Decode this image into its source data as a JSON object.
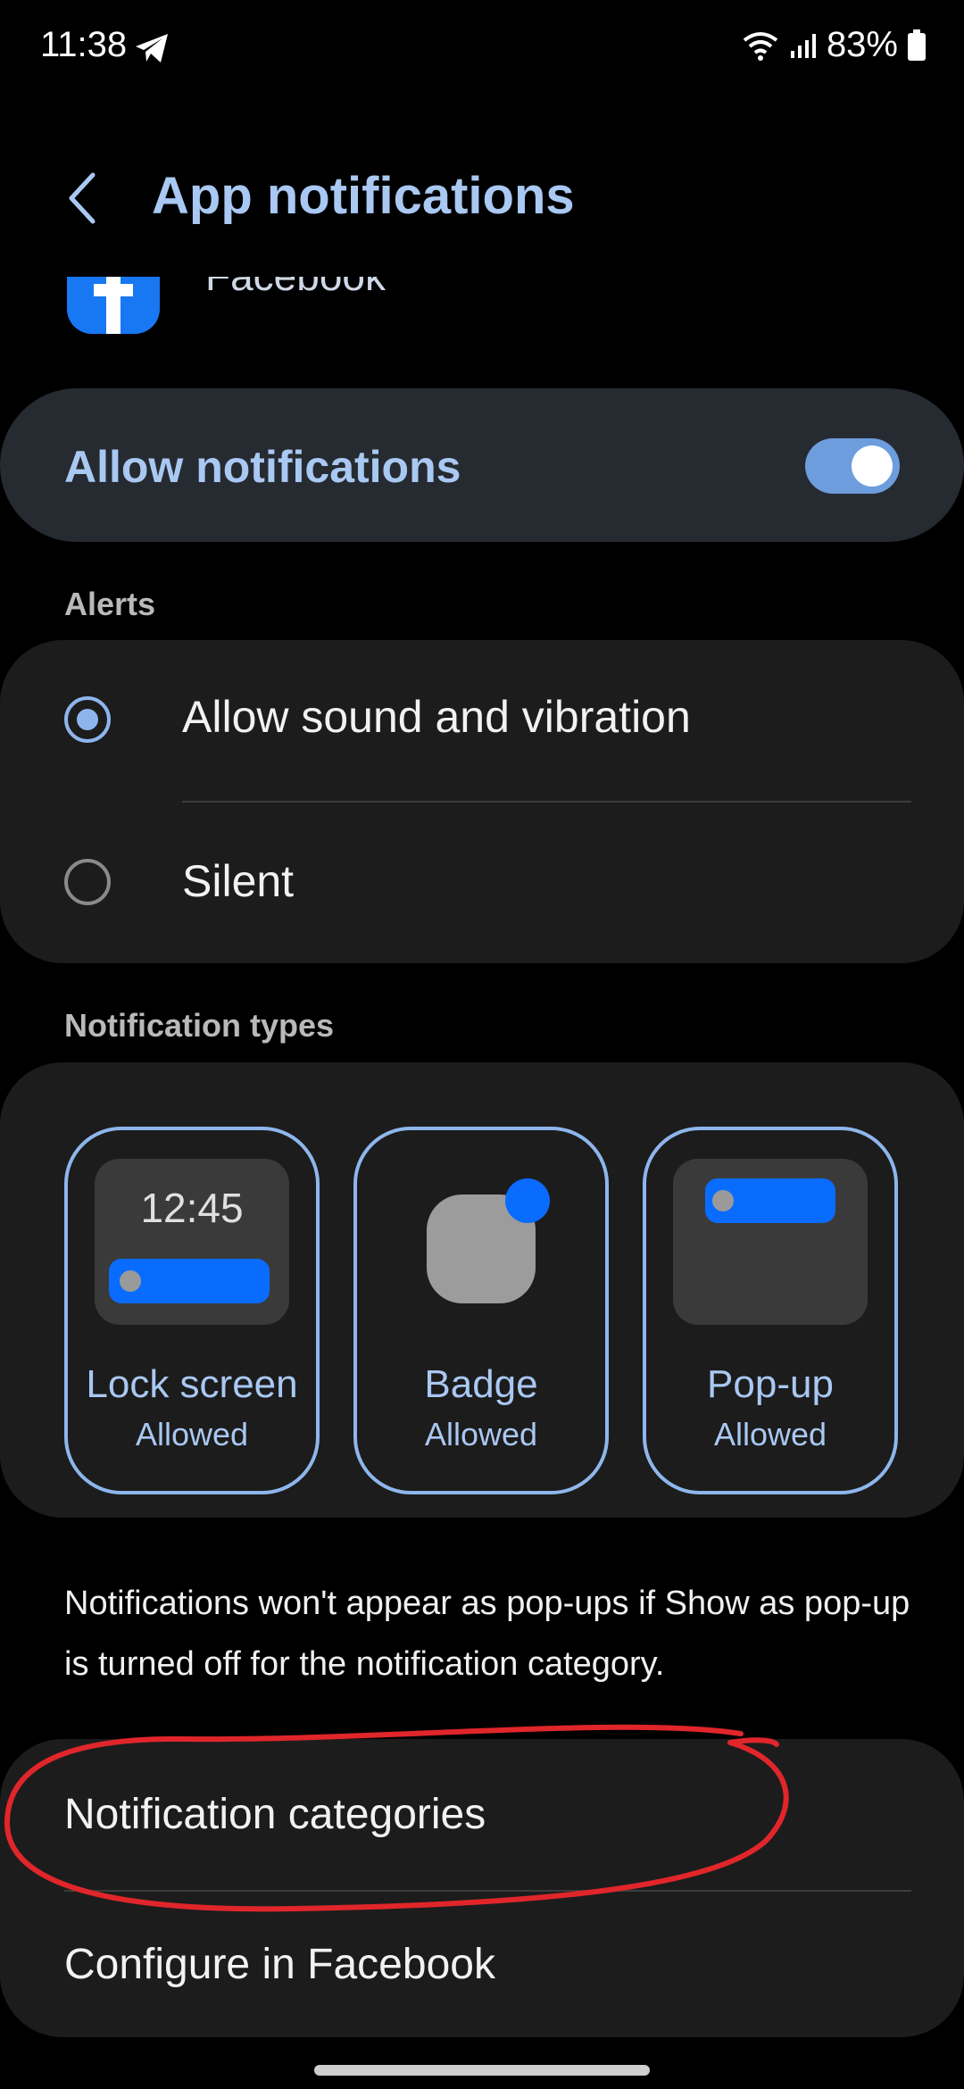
{
  "status_bar": {
    "time": "11:38",
    "battery": "83%"
  },
  "header": {
    "title": "App notifications"
  },
  "app": {
    "name": "Facebook",
    "icon_color": "#1877f2"
  },
  "allow_notifications": {
    "label": "Allow notifications",
    "enabled": true
  },
  "alerts": {
    "section_label": "Alerts",
    "options": [
      {
        "label": "Allow sound and vibration",
        "selected": true
      },
      {
        "label": "Silent",
        "selected": false
      }
    ]
  },
  "notification_types": {
    "section_label": "Notification types",
    "tiles": [
      {
        "name": "Lock screen",
        "status": "Allowed",
        "preview_time": "12:45"
      },
      {
        "name": "Badge",
        "status": "Allowed"
      },
      {
        "name": "Pop-up",
        "status": "Allowed"
      }
    ]
  },
  "info_text": "Notifications won't appear as pop-ups if Show as pop-up is turned off for the notification category.",
  "menu": {
    "items": [
      {
        "label": "Notification categories"
      },
      {
        "label": "Configure in Facebook"
      }
    ]
  },
  "colors": {
    "accent": "#a9c8f2",
    "toggle": "#6d9ddd",
    "annotation": "#e0262a"
  }
}
